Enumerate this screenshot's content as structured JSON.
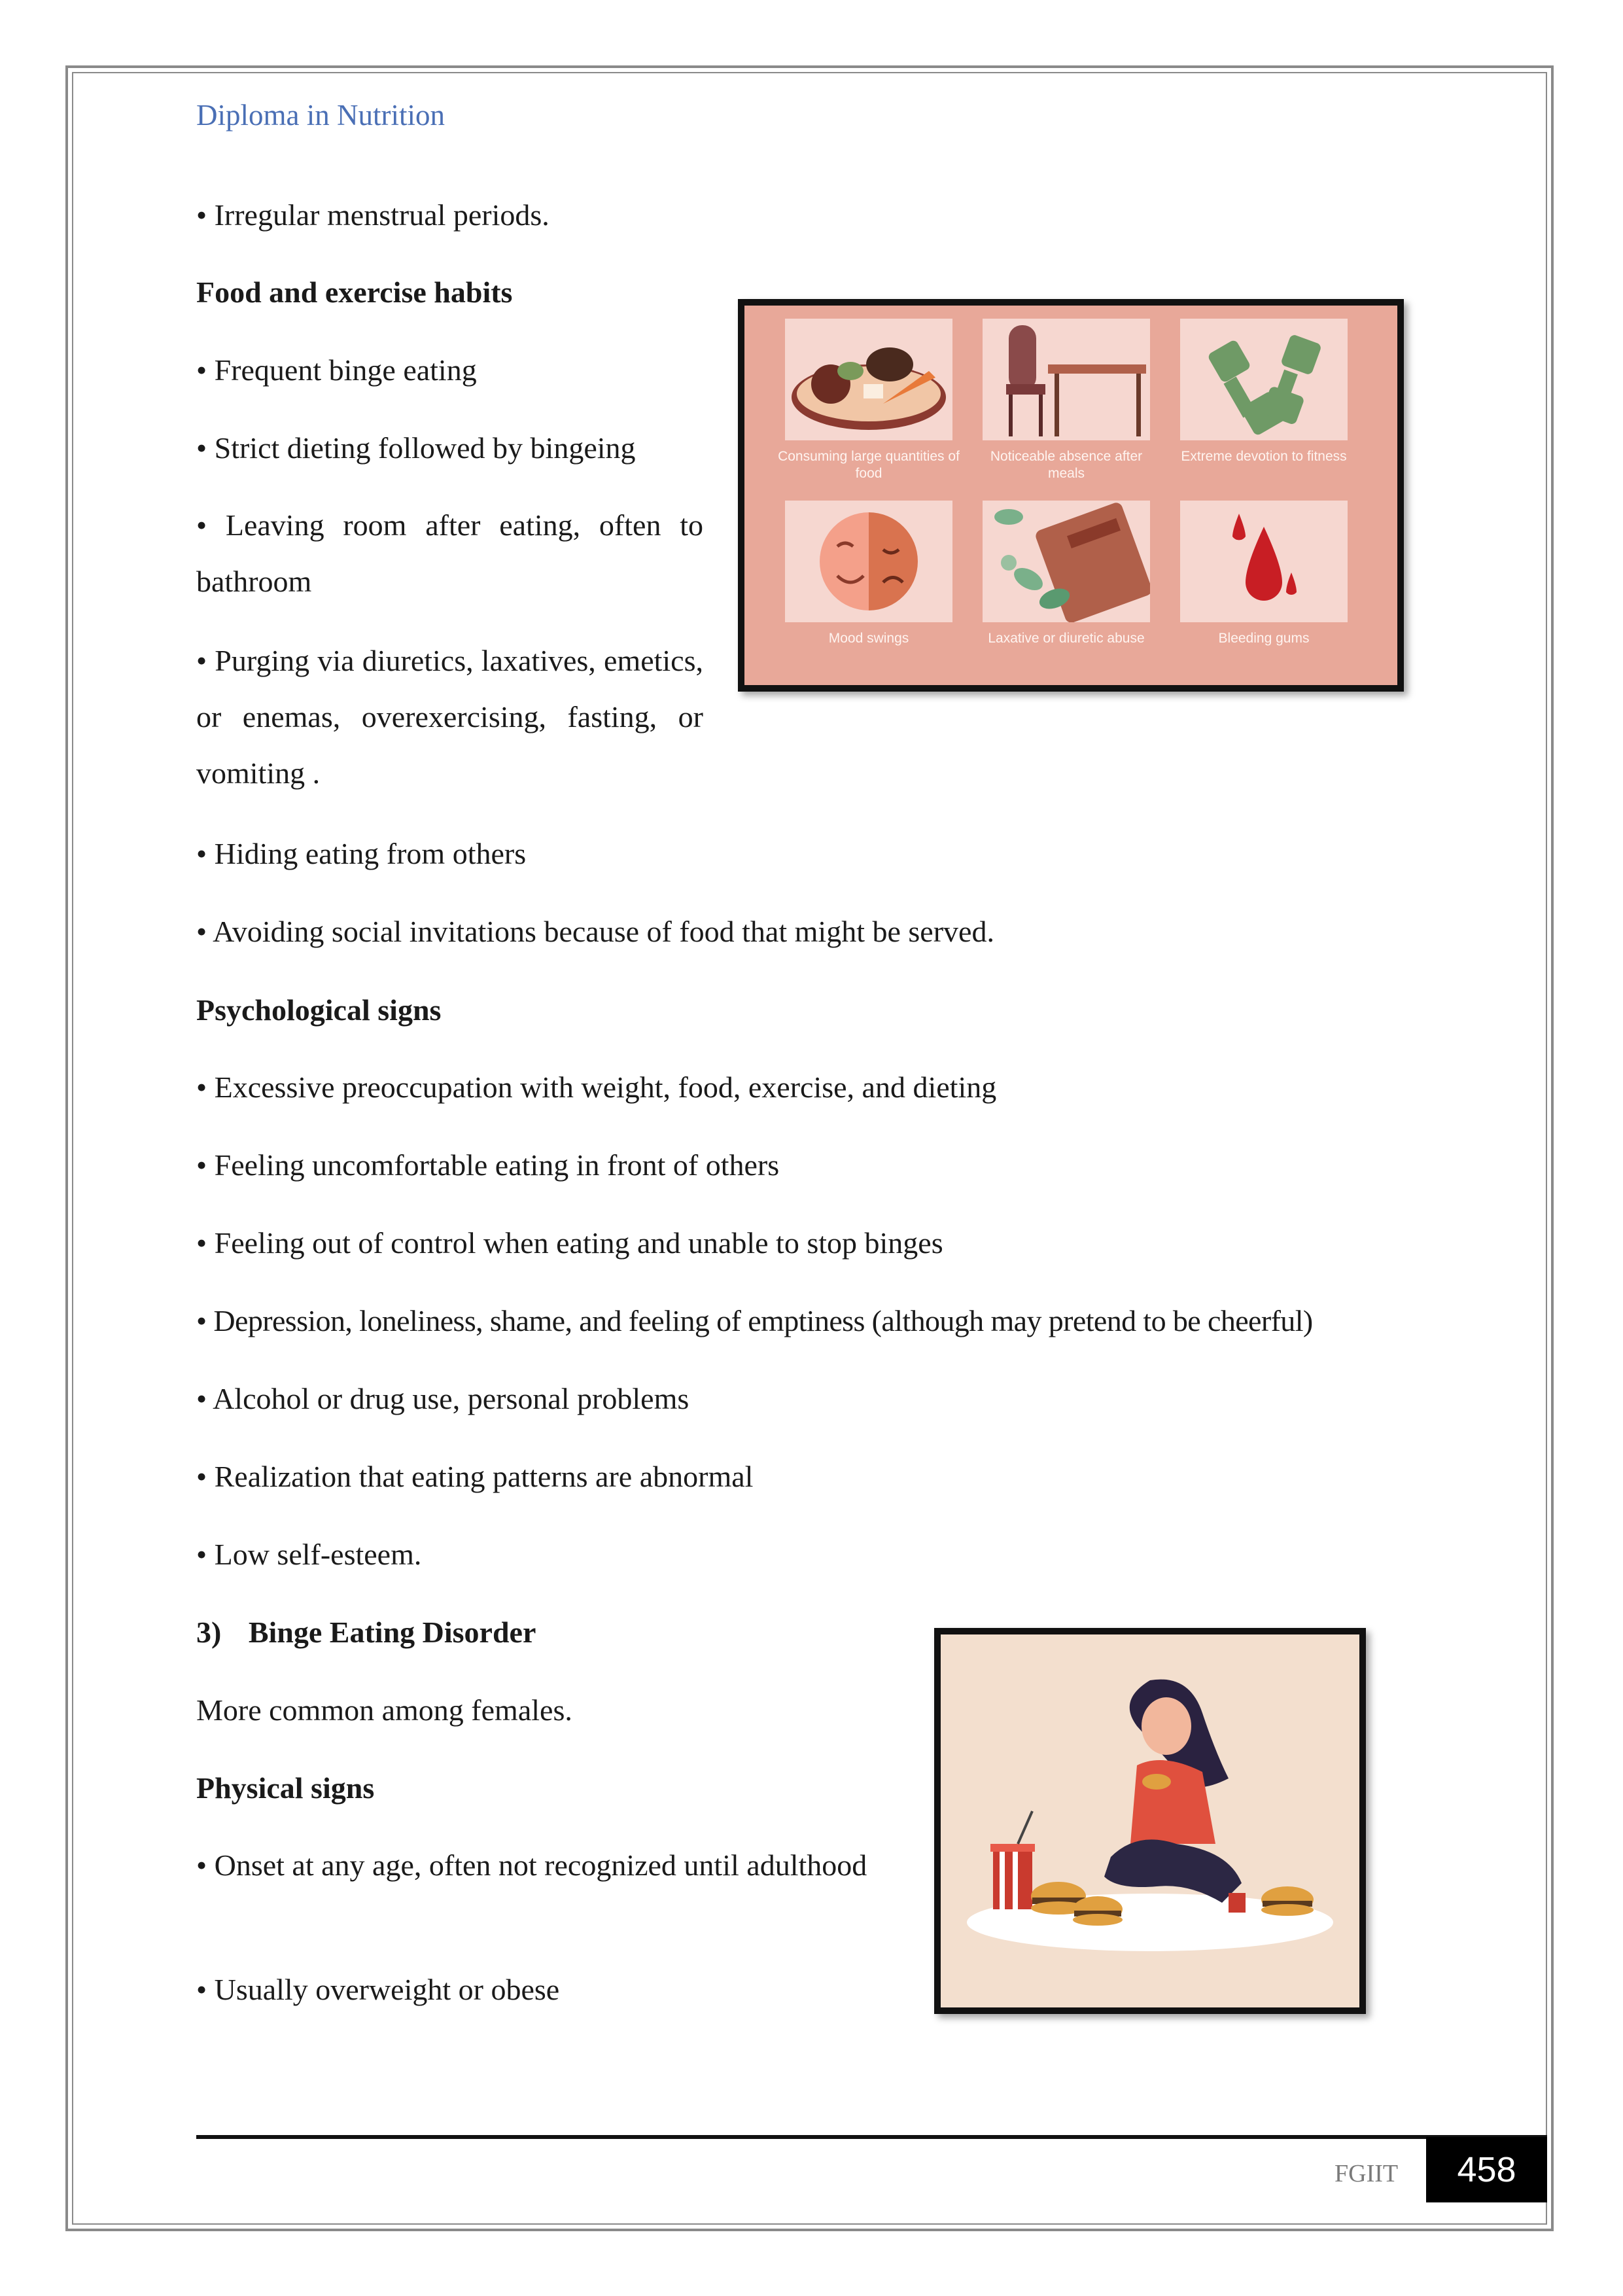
{
  "header": {
    "title": "Diploma in Nutrition"
  },
  "content": {
    "line_menstrual": "• Irregular menstrual periods.",
    "heading_food": "Food and exercise habits",
    "food_items": [
      "• Frequent binge eating",
      "• Strict dieting followed by bingeing",
      "• Leaving room after eating, often to bathroom",
      "• Purging via diuretics, laxatives, emetics, or enemas, overexercising, fasting, or vomiting .",
      "• Hiding eating from others",
      "• Avoiding social invitations because of food that might be served."
    ],
    "heading_psych": "Psychological signs",
    "psych_items": [
      "• Excessive preoccupation with weight, food, exercise, and dieting",
      " • Feeling uncomfortable eating in front of others",
      "• Feeling out of control when eating and unable to stop binges",
      "• Depression, loneliness, shame, and feeling of emptiness (although may pretend to be cheerful)",
      "• Alcohol or drug use, personal problems",
      "• Realization that eating patterns are abnormal",
      "• Low self-esteem."
    ],
    "heading_bed_number": "3)",
    "heading_bed": "Binge Eating Disorder",
    "bed_intro": "More common among females.",
    "heading_physical": "Physical signs",
    "physical_items": [
      "• Onset at any age, often not recognized until adulthood",
      "• Usually overweight or obese"
    ]
  },
  "figure_signs": {
    "captions": [
      "Consuming large quantities of food",
      "Noticeable absence after meals",
      "Extreme devotion to fitness",
      "Mood swings",
      "Laxative or diuretic abuse",
      "Bleeding gums"
    ],
    "colors": {
      "background": "#e8a899",
      "tile": "#f6d7d0"
    }
  },
  "footer": {
    "brand": "FGIIT",
    "page_number": "458"
  }
}
